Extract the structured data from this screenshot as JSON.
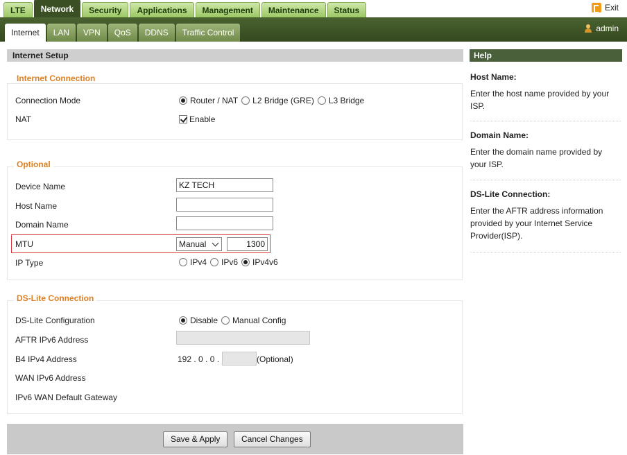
{
  "top_nav": {
    "tabs": [
      "LTE",
      "Network",
      "Security",
      "Applications",
      "Management",
      "Maintenance",
      "Status"
    ],
    "active_tab": "Network",
    "exit_label": "Exit"
  },
  "sub_nav": {
    "tabs": [
      "Internet",
      "LAN",
      "VPN",
      "QoS",
      "DDNS",
      "Traffic Control"
    ],
    "active_tab": "Internet",
    "user_label": "admin"
  },
  "page": {
    "title": "Internet Setup"
  },
  "internet_connection": {
    "legend": "Internet Connection",
    "connection_mode": {
      "label": "Connection Mode",
      "options": [
        "Router / NAT",
        "L2 Bridge (GRE)",
        "L3 Bridge"
      ],
      "selected": "Router / NAT"
    },
    "nat": {
      "label": "NAT",
      "checkbox_label": "Enable",
      "checked": true
    }
  },
  "optional": {
    "legend": "Optional",
    "device_name": {
      "label": "Device Name",
      "value": "KZ TECH"
    },
    "host_name": {
      "label": "Host Name",
      "value": ""
    },
    "domain_name": {
      "label": "Domain Name",
      "value": ""
    },
    "mtu": {
      "label": "MTU",
      "mode": "Manual",
      "value": "1300"
    },
    "ip_type": {
      "label": "IP Type",
      "options": [
        "IPv4",
        "IPv6",
        "IPv4v6"
      ],
      "selected": "IPv4v6"
    }
  },
  "ds_lite": {
    "legend": "DS-Lite Connection",
    "configuration": {
      "label": "DS-Lite Configuration",
      "options": [
        "Disable",
        "Manual Config"
      ],
      "selected": "Disable"
    },
    "aftr": {
      "label": "AFTR IPv6 Address",
      "value": ""
    },
    "b4": {
      "label": "B4 IPv4 Address",
      "prefix": "192 . 0 . 0 .",
      "value": "",
      "suffix": "(Optional)"
    },
    "wan_ipv6": {
      "label": "WAN IPv6 Address"
    },
    "gateway": {
      "label": "IPv6 WAN Default Gateway"
    }
  },
  "actions": {
    "save": "Save & Apply",
    "cancel": "Cancel Changes"
  },
  "help": {
    "header": "Help",
    "sections": [
      {
        "title": "Host Name:",
        "text": "Enter the host name provided by your ISP."
      },
      {
        "title": "Domain Name:",
        "text": "Enter the domain name provided by your ISP."
      },
      {
        "title": "DS-Lite Connection:",
        "text": "Enter the AFTR address information provided by your Internet Service Provider(ISP)."
      }
    ]
  },
  "colors": {
    "nav_dark": "#3b4f25",
    "tab_green": "#9cc764",
    "legend_orange": "#e07f20",
    "help_header": "#49603a",
    "highlight_red": "#d9353f"
  }
}
